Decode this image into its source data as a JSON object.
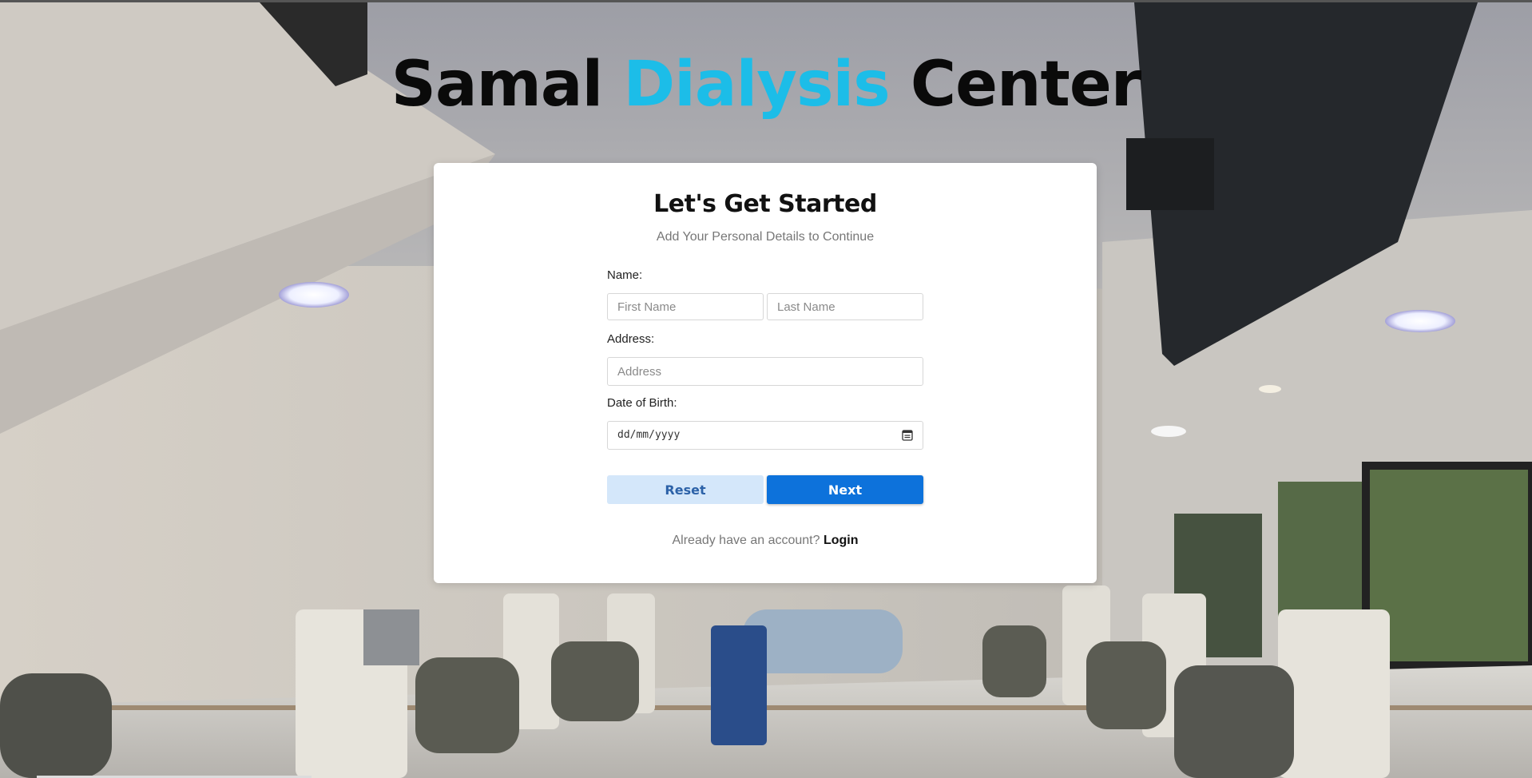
{
  "brand": {
    "part1": "Samal",
    "part2": "Dialysis",
    "part3": "Center",
    "accent_color": "#1cbde8"
  },
  "card": {
    "title": "Let's Get Started",
    "subtitle": "Add Your Personal Details to Continue"
  },
  "form": {
    "name_label": "Name:",
    "first_name_placeholder": "First Name",
    "last_name_placeholder": "Last Name",
    "address_label": "Address:",
    "address_placeholder": "Address",
    "dob_label": "Date of Birth:",
    "dob_placeholder": "dd/mm/yyyy",
    "calendar_icon": "calendar-icon"
  },
  "buttons": {
    "reset": "Reset",
    "next": "Next",
    "next_color": "#0d72db",
    "reset_color": "#d4e7fa"
  },
  "footer": {
    "prompt": "Already have an account?",
    "login_link": "Login"
  },
  "background": {
    "scene": "dialysis-room-photo"
  }
}
